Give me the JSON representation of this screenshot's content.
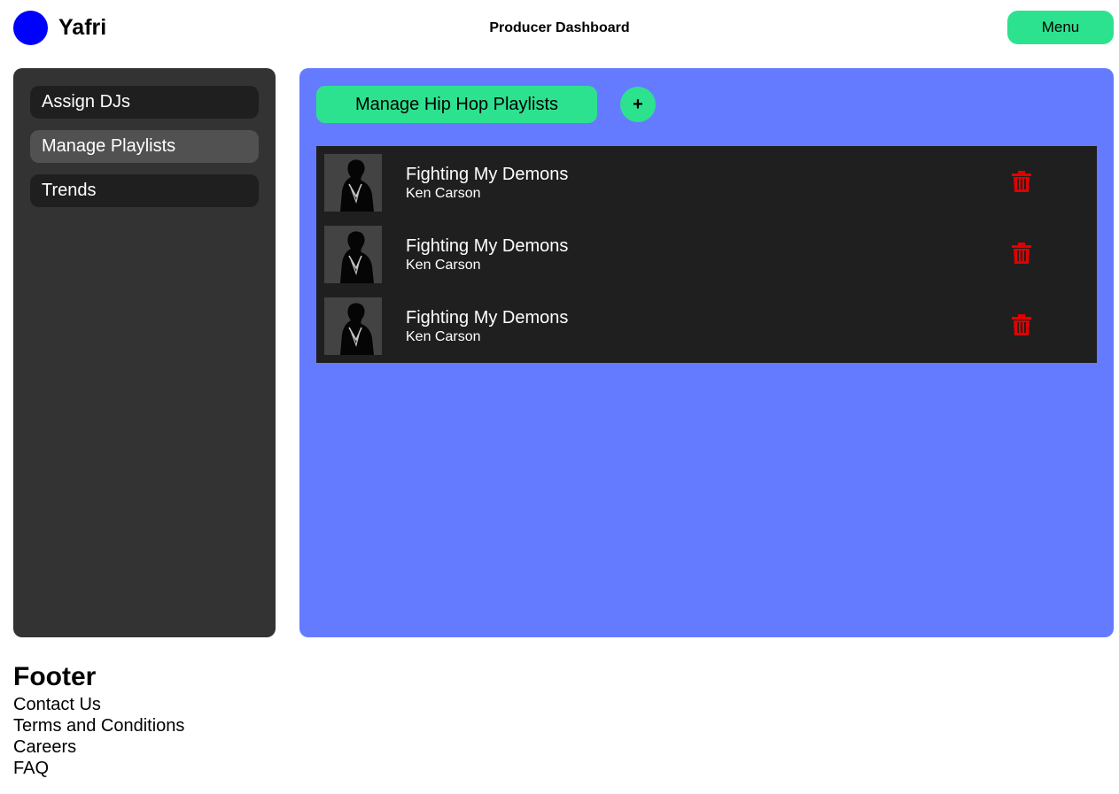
{
  "header": {
    "brand": "Yafri",
    "title": "Producer Dashboard",
    "menu_label": "Menu",
    "logo_color": "#0000ff"
  },
  "sidebar": {
    "items": [
      {
        "label": "Assign DJs",
        "active": false
      },
      {
        "label": "Manage Playlists",
        "active": true
      },
      {
        "label": "Trends",
        "active": false
      }
    ]
  },
  "main": {
    "playlist_button_label": "Manage Hip Hop Playlists",
    "add_button_label": "+",
    "tracks": [
      {
        "title": "Fighting My Demons",
        "artist": "Ken Carson",
        "cover_icon": "album-cover-image",
        "delete_icon": "trash-icon"
      },
      {
        "title": "Fighting My Demons",
        "artist": "Ken Carson",
        "cover_icon": "album-cover-image",
        "delete_icon": "trash-icon"
      },
      {
        "title": "Fighting My Demons",
        "artist": "Ken Carson",
        "cover_icon": "album-cover-image",
        "delete_icon": "trash-icon"
      }
    ]
  },
  "footer": {
    "title": "Footer",
    "links": [
      "Contact Us",
      "Terms and Conditions",
      "Careers",
      "FAQ"
    ]
  },
  "colors": {
    "accent": "#2de28f",
    "main_panel": "#657bff",
    "sidebar": "#333333",
    "track_list": "#1f1f1f",
    "delete": "#e00000"
  }
}
